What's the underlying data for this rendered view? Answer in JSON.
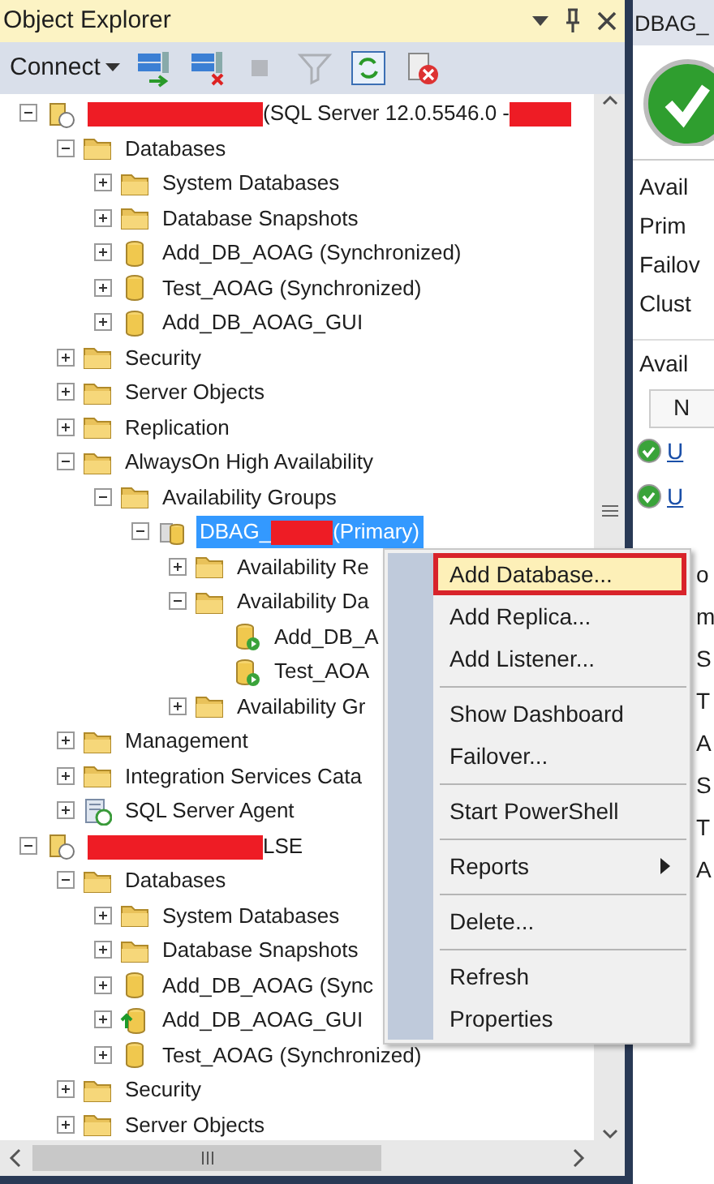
{
  "panel": {
    "title": "Object Explorer"
  },
  "toolbar": {
    "connect": "Connect",
    "buttons": [
      {
        "kind": "connect",
        "disabled": false
      },
      {
        "kind": "disconnect",
        "disabled": false
      },
      {
        "kind": "stop",
        "disabled": true
      },
      {
        "kind": "filter",
        "disabled": true
      },
      {
        "kind": "refresh",
        "disabled": false
      },
      {
        "kind": "script",
        "disabled": false
      }
    ]
  },
  "tree": [
    {
      "kind": "server",
      "expanded": true,
      "selected": false,
      "label_parts": [
        {
          "kind": "redaction"
        },
        {
          "kind": "text",
          "text": "(SQL Server 12.0.5546.0 -"
        },
        {
          "kind": "redaction"
        }
      ],
      "children": [
        {
          "kind": "folder",
          "label": "Databases",
          "expanded": true,
          "selected": false,
          "children": [
            {
              "kind": "folder",
              "label": "System Databases",
              "expanded": false,
              "selected": false
            },
            {
              "kind": "folder",
              "label": "Database Snapshots",
              "expanded": false,
              "selected": false
            },
            {
              "kind": "database",
              "label": "Add_DB_AOAG (Synchronized)",
              "expanded": false,
              "selected": false
            },
            {
              "kind": "database",
              "label": "Test_AOAG (Synchronized)",
              "expanded": false,
              "selected": false
            },
            {
              "kind": "database",
              "label": "Add_DB_AOAG_GUI",
              "expanded": false,
              "selected": false
            }
          ]
        },
        {
          "kind": "folder",
          "label": "Security",
          "expanded": false,
          "selected": false
        },
        {
          "kind": "folder",
          "label": "Server Objects",
          "expanded": false,
          "selected": false
        },
        {
          "kind": "folder",
          "label": "Replication",
          "expanded": false,
          "selected": false
        },
        {
          "kind": "folder",
          "label": "AlwaysOn High Availability",
          "expanded": true,
          "selected": false,
          "children": [
            {
              "kind": "folder",
              "label": "Availability Groups",
              "expanded": true,
              "selected": false,
              "children": [
                {
                  "kind": "group",
                  "expanded": true,
                  "selected": true,
                  "label_parts": [
                    {
                      "kind": "text",
                      "text": "DBAG_"
                    },
                    {
                      "kind": "redaction"
                    },
                    {
                      "kind": "text",
                      "text": "(Primary)"
                    }
                  ],
                  "children": [
                    {
                      "kind": "folder",
                      "label": "Availability Re",
                      "expanded": false,
                      "selected": false
                    },
                    {
                      "kind": "folder",
                      "label": "Availability Da",
                      "expanded": true,
                      "selected": false,
                      "children": [
                        {
                          "kind": "group-database",
                          "label": "Add_DB_A",
                          "selected": false
                        },
                        {
                          "kind": "group-database",
                          "label": "Test_AOA",
                          "selected": false
                        }
                      ]
                    },
                    {
                      "kind": "folder",
                      "label": "Availability Gr",
                      "expanded": false,
                      "selected": false
                    }
                  ]
                }
              ]
            }
          ]
        },
        {
          "kind": "folder",
          "label": "Management",
          "expanded": false,
          "selected": false
        },
        {
          "kind": "folder",
          "label": "Integration Services Cata",
          "expanded": false,
          "selected": false
        },
        {
          "kind": "agent",
          "label": "SQL Server Agent",
          "expanded": false,
          "selected": false
        }
      ]
    },
    {
      "kind": "server",
      "expanded": true,
      "selected": false,
      "label_parts": [
        {
          "kind": "redaction"
        },
        {
          "kind": "text",
          "text": "LSE"
        }
      ],
      "children": [
        {
          "kind": "folder",
          "label": "Databases",
          "expanded": true,
          "selected": false,
          "children": [
            {
              "kind": "folder",
              "label": "System Databases",
              "expanded": false,
              "selected": false
            },
            {
              "kind": "folder",
              "label": "Database Snapshots",
              "expanded": false,
              "selected": false
            },
            {
              "kind": "database",
              "label": "Add_DB_AOAG (Sync",
              "expanded": false,
              "selected": false
            },
            {
              "kind": "restoring-database",
              "label": "Add_DB_AOAG_GUI",
              "expanded": false,
              "selected": false
            },
            {
              "kind": "database",
              "label": "Test_AOAG (Synchronized)",
              "expanded": false,
              "selected": false
            }
          ]
        },
        {
          "kind": "folder",
          "label": "Security",
          "expanded": false,
          "selected": false
        },
        {
          "kind": "folder",
          "label": "Server Objects",
          "expanded": false,
          "selected": false
        }
      ]
    }
  ],
  "context_menu": [
    {
      "kind": "item",
      "label": "Add Database...",
      "highlighted": true,
      "outlined": true
    },
    {
      "kind": "item",
      "label": "Add Replica...",
      "highlighted": false,
      "outlined": false
    },
    {
      "kind": "item",
      "label": "Add Listener...",
      "highlighted": false,
      "outlined": false
    },
    {
      "kind": "separator"
    },
    {
      "kind": "item",
      "label": "Show Dashboard",
      "highlighted": false,
      "outlined": false
    },
    {
      "kind": "item",
      "label": "Failover...",
      "highlighted": false,
      "outlined": false
    },
    {
      "kind": "separator"
    },
    {
      "kind": "item",
      "label": "Start PowerShell",
      "highlighted": false,
      "outlined": false
    },
    {
      "kind": "separator"
    },
    {
      "kind": "submenu",
      "label": "Reports",
      "highlighted": false,
      "outlined": false
    },
    {
      "kind": "separator"
    },
    {
      "kind": "item",
      "label": "Delete...",
      "highlighted": false,
      "outlined": false
    },
    {
      "kind": "separator"
    },
    {
      "kind": "item",
      "label": "Refresh",
      "highlighted": false,
      "outlined": false
    },
    {
      "kind": "item",
      "label": "Properties",
      "highlighted": false,
      "outlined": false
    }
  ],
  "dashboard": {
    "tab": "DBAG_",
    "labels": [
      "Avail",
      "Prim",
      "Failov",
      "Clust"
    ],
    "section": "Avail",
    "table_header": "N",
    "links": [
      "U",
      "U"
    ],
    "fragments": [
      "o",
      "m",
      "S",
      "T",
      "A",
      "S",
      "T",
      "A"
    ]
  }
}
